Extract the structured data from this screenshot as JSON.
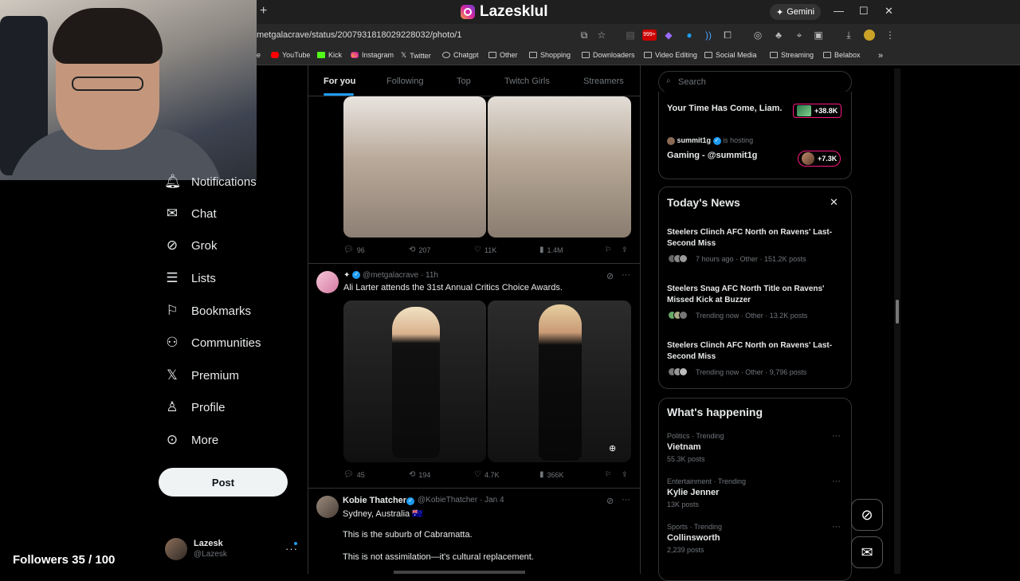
{
  "browser": {
    "window_title": "Lazesklul",
    "url": "metgalacrave/status/2007931818029228032/photo/1",
    "gemini_label": "Gemini",
    "new_tab": "+",
    "bookmarks": [
      {
        "label": "YouTube",
        "icon": "youtube-icon"
      },
      {
        "label": "Kick",
        "icon": "kick-icon"
      },
      {
        "label": "Instagram",
        "icon": "instagram-icon"
      },
      {
        "label": "Twitter",
        "icon": "x-icon"
      },
      {
        "label": "Chatgpt",
        "icon": "chatgpt-icon"
      },
      {
        "label": "Other",
        "icon": "folder-icon"
      },
      {
        "label": "Shopping",
        "icon": "folder-icon"
      },
      {
        "label": "Downloaders",
        "icon": "folder-icon"
      },
      {
        "label": "Video Editing",
        "icon": "folder-icon"
      },
      {
        "label": "Social Media",
        "icon": "folder-icon"
      },
      {
        "label": "Streaming",
        "icon": "folder-icon"
      },
      {
        "label": "Belabox",
        "icon": "folder-icon"
      }
    ],
    "extension_badge": "999+"
  },
  "nav": {
    "items": [
      {
        "label": "Notifications",
        "icon": "bell-icon"
      },
      {
        "label": "Chat",
        "icon": "mail-icon"
      },
      {
        "label": "Grok",
        "icon": "grok-icon"
      },
      {
        "label": "Lists",
        "icon": "list-icon"
      },
      {
        "label": "Bookmarks",
        "icon": "bookmark-icon"
      },
      {
        "label": "Communities",
        "icon": "communities-icon"
      },
      {
        "label": "Premium",
        "icon": "x-icon"
      },
      {
        "label": "Profile",
        "icon": "person-icon"
      },
      {
        "label": "More",
        "icon": "more-circle-icon"
      }
    ],
    "post_label": "Post",
    "profile": {
      "name": "Lazesk",
      "handle": "@Lazesk"
    }
  },
  "overlay": {
    "followers": "Followers 35 / 100"
  },
  "timeline": {
    "tabs": [
      "For you",
      "Following",
      "Top",
      "Twitch Girls",
      "Streamers"
    ],
    "tweets": [
      {
        "replies": "96",
        "reposts": "207",
        "likes": "11K",
        "views": "1.4M"
      },
      {
        "handle": "@metgalacrave",
        "time": "11h",
        "text": "Ali Larter attends the 31st Annual Critics Choice Awards.",
        "replies": "45",
        "reposts": "194",
        "likes": "4.7K",
        "views": "366K"
      },
      {
        "name": "Kobie Thatcher",
        "handle": "@KobieThatcher",
        "time": "Jan 4",
        "lines": [
          "Sydney, Australia 🇦🇺",
          "This is the suburb of Cabramatta.",
          "This is not assimilation—it's cultural replacement."
        ]
      }
    ]
  },
  "right": {
    "search_placeholder": "Search",
    "live": [
      {
        "title": "Your Time Has Come, Liam.",
        "count": "+38.8K"
      },
      {
        "host": "summit1g",
        "status": "is hosting",
        "title": "Gaming - @summit1g",
        "count": "+7.3K"
      }
    ],
    "news": {
      "title": "Today's News",
      "items": [
        {
          "title": "Steelers Clinch AFC North on Ravens' Last-Second Miss",
          "meta": "7 hours ago · Other · 151.2K posts"
        },
        {
          "title": "Steelers Snag AFC North Title on Ravens' Missed Kick at Buzzer",
          "meta": "Trending now · Other · 13.2K posts"
        },
        {
          "title": "Steelers Clinch AFC North on Ravens' Last-Second Miss",
          "meta": "Trending now · Other · 9,796 posts"
        }
      ]
    },
    "happening": {
      "title": "What's happening",
      "items": [
        {
          "category": "Politics · Trending",
          "name": "Vietnam",
          "count": "55.3K posts"
        },
        {
          "category": "Entertainment · Trending",
          "name": "Kylie Jenner",
          "count": "13K posts"
        },
        {
          "category": "Sports · Trending",
          "name": "Collinsworth",
          "count": "2,239 posts"
        }
      ]
    }
  },
  "colors": {
    "accent": "#1d9bf0",
    "live_border": "#f91880",
    "background": "#000000"
  }
}
